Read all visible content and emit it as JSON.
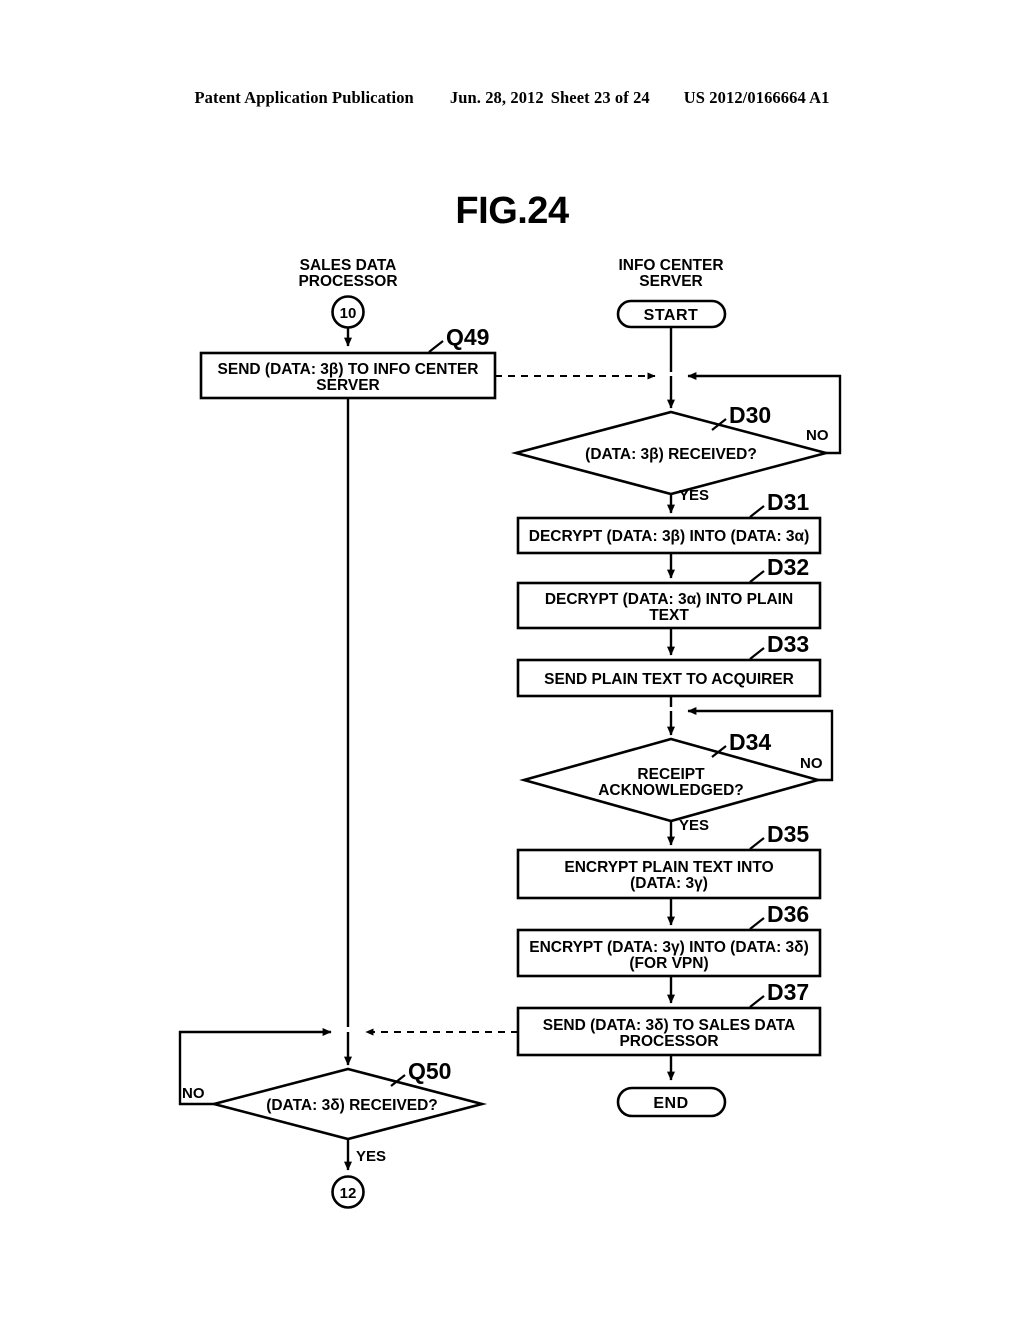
{
  "header": {
    "publication": "Patent Application Publication",
    "date": "Jun. 28, 2012",
    "sheet": "Sheet 23 of 24",
    "number": "US 2012/0166664 A1"
  },
  "figure": {
    "title": "FIG.24"
  },
  "columns": {
    "left": {
      "line1": "SALES DATA",
      "line2": "PROCESSOR"
    },
    "right": {
      "line1": "INFO CENTER",
      "line2": "SERVER"
    }
  },
  "connectors": {
    "entry": "10",
    "exit": "12"
  },
  "terminators": {
    "start": "START",
    "end": "END"
  },
  "branch_labels": {
    "yes": "YES",
    "no": "NO"
  },
  "steps": [
    {
      "id": "Q49",
      "kind": "process",
      "lane": "left",
      "line1": "SEND (DATA: 3β) TO INFO CENTER",
      "line2": "SERVER"
    },
    {
      "id": "D30",
      "kind": "decision",
      "lane": "right",
      "line1": "(DATA: 3β) RECEIVED?",
      "line2": ""
    },
    {
      "id": "D31",
      "kind": "process",
      "lane": "right",
      "line1": "DECRYPT (DATA: 3β) INTO (DATA: 3α)",
      "line2": ""
    },
    {
      "id": "D32",
      "kind": "process",
      "lane": "right",
      "line1": "DECRYPT (DATA: 3α) INTO PLAIN",
      "line2": "TEXT"
    },
    {
      "id": "D33",
      "kind": "process",
      "lane": "right",
      "line1": "SEND PLAIN TEXT TO ACQUIRER",
      "line2": ""
    },
    {
      "id": "D34",
      "kind": "decision",
      "lane": "right",
      "line1": "RECEIPT",
      "line2": "ACKNOWLEDGED?"
    },
    {
      "id": "D35",
      "kind": "process",
      "lane": "right",
      "line1": "ENCRYPT PLAIN TEXT INTO",
      "line2": "(DATA: 3γ)"
    },
    {
      "id": "D36",
      "kind": "process",
      "lane": "right",
      "line1": "ENCRYPT (DATA: 3γ) INTO (DATA: 3δ)",
      "line2": "(FOR VPN)"
    },
    {
      "id": "D37",
      "kind": "process",
      "lane": "right",
      "line1": "SEND (DATA: 3δ) TO SALES DATA",
      "line2": "PROCESSOR"
    },
    {
      "id": "Q50",
      "kind": "decision",
      "lane": "left",
      "line1": "(DATA: 3δ) RECEIVED?",
      "line2": ""
    }
  ],
  "colors": {
    "ink": "#000000",
    "paper": "#ffffff"
  }
}
